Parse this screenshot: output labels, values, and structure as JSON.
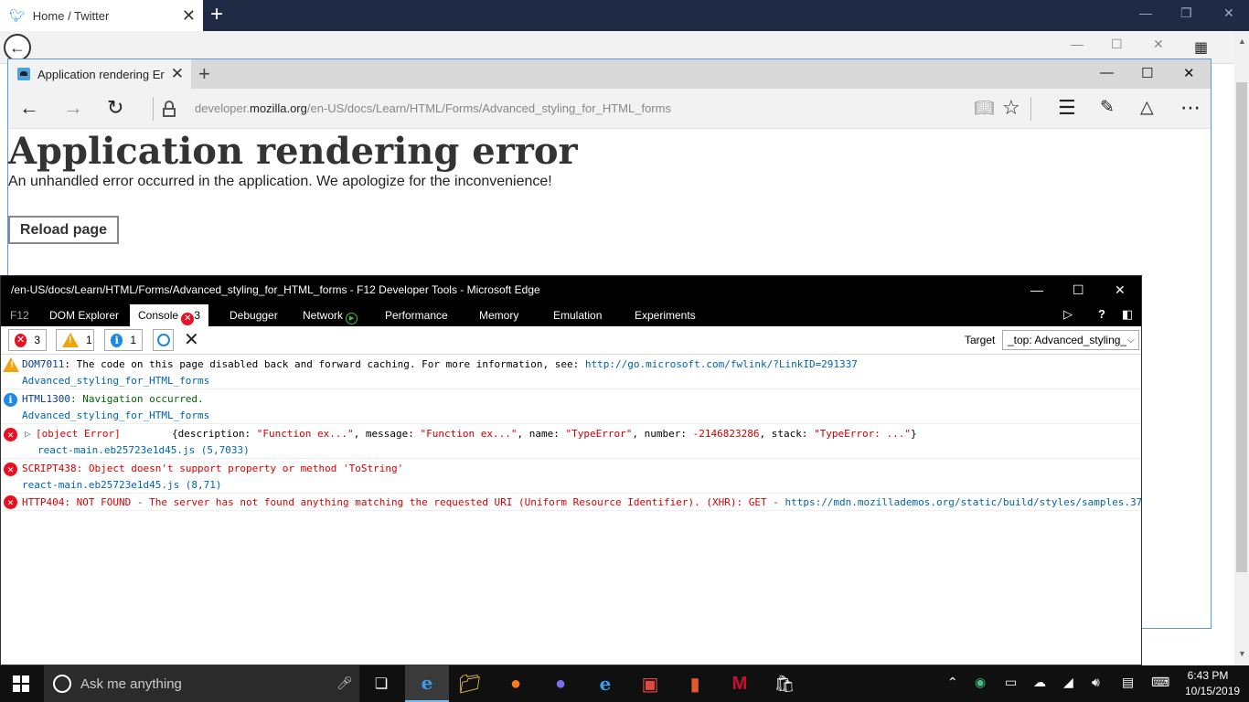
{
  "bg_browser": {
    "tab_title": "Home / Twitter",
    "tab_close": "✕",
    "new_tab": "+",
    "min": "—",
    "restore": "❐",
    "close": "✕"
  },
  "edge": {
    "tab_title": "Application rendering Er",
    "tab_close": "✕",
    "new_tab": "+",
    "min": "—",
    "max": "☐",
    "close": "✕",
    "url_prefix": "developer.",
    "url_domain": "mozilla.org",
    "url_path": "/en-US/docs/Learn/HTML/Forms/Advanced_styling_for_HTML_forms"
  },
  "page": {
    "title": "Application rendering error",
    "description": "An unhandled error occurred in the application. We apologize for the inconvenience!",
    "reload_button": "Reload page"
  },
  "devtools": {
    "title": "/en-US/docs/Learn/HTML/Forms/Advanced_styling_for_HTML_forms - F12 Developer Tools - Microsoft Edge",
    "tabs": {
      "f12": "F12",
      "dom": "DOM Explorer",
      "console": "Console",
      "console_count": "3",
      "debugger": "Debugger",
      "network": "Network",
      "performance": "Performance",
      "memory": "Memory",
      "emulation": "Emulation",
      "experiments": "Experiments"
    },
    "filters": {
      "errors": "3",
      "warnings": "1",
      "info": "1"
    },
    "target_label": "Target",
    "target_value": "_top: Advanced_styling_",
    "messages": [
      {
        "type": "warning",
        "code": "DOM7011",
        "text": ": The code on this page disabled back and forward caching. For more information, see: ",
        "link": "http://go.microsoft.com/fwlink/?LinkID=291337",
        "source": "Advanced_styling_for_HTML_forms"
      },
      {
        "type": "info",
        "code": "HTML1300",
        "text": ": Navigation occurred.",
        "source": "Advanced_styling_for_HTML_forms"
      },
      {
        "type": "error",
        "object": "[object Error]",
        "open": "{description: ",
        "description": "\"Function ex...\"",
        "message_key": ", message: ",
        "message": "\"Function ex...\"",
        "name_key": ", name: ",
        "name": "\"TypeError\"",
        "number_key": ", number: ",
        "number": "-2146823286",
        "stack_key": ", stack: ",
        "stack": "\"TypeError: ...\"",
        "close": "}",
        "source": "react-main.eb25723e1d45.js (5,7033)"
      },
      {
        "type": "error",
        "code": "SCRIPT438",
        "text": ": Object doesn't support property or method 'ToString'",
        "source": "react-main.eb25723e1d45.js (8,71)"
      },
      {
        "type": "error",
        "code": "HTTP404",
        "text": ": NOT FOUND - The server has not found anything matching the requested URI (Uniform Resource Identifier). (XHR): GET - ",
        "link": "https://mdn.mozillademos.org/static/build/styles/samples.37"
      }
    ]
  },
  "taskbar": {
    "search_placeholder": "Ask me anything",
    "time": "6:43 PM",
    "date": "10/15/2019"
  },
  "colors": {
    "edge_accent": "#5a9bd5",
    "error": "#e81123",
    "warning": "#f0a30a",
    "info": "#1e88e5"
  }
}
